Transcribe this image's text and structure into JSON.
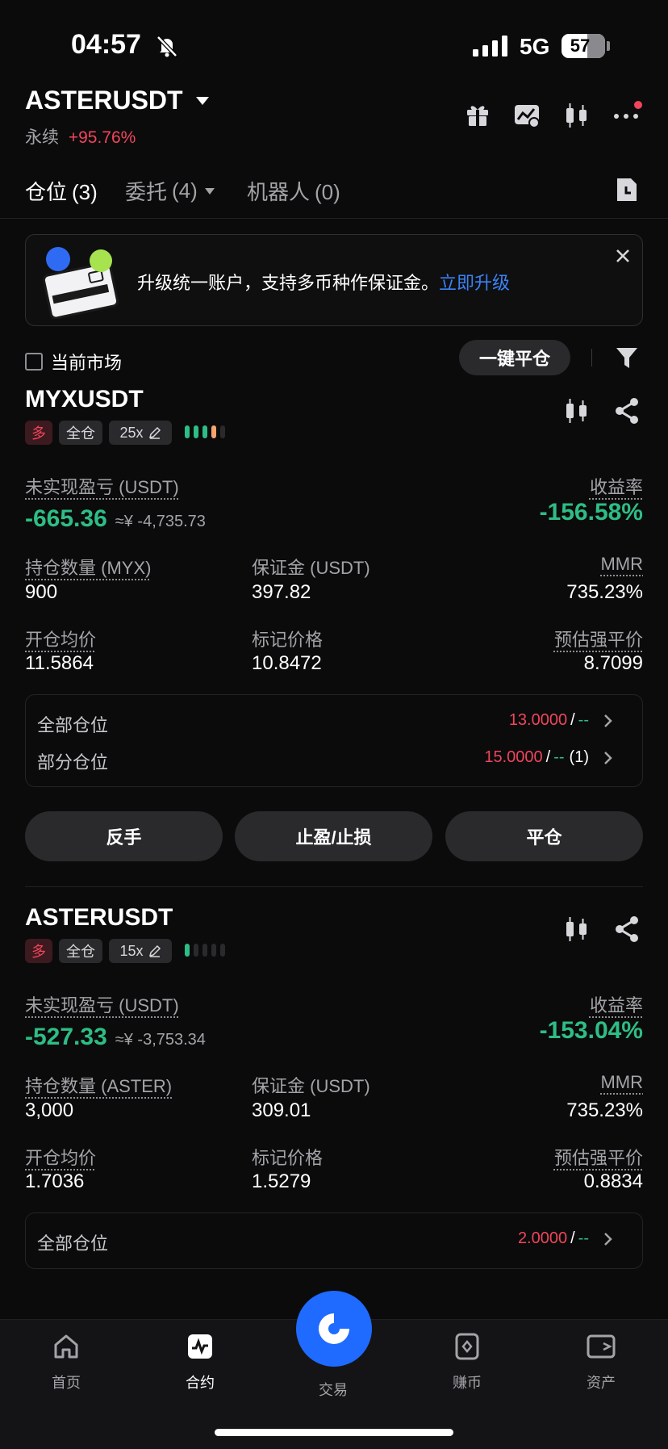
{
  "status": {
    "time": "04:57",
    "network": "5G",
    "battery": "57"
  },
  "header": {
    "symbol": "ASTERUSDT",
    "type": "永续",
    "change": "+95.76%"
  },
  "tabs": [
    {
      "label": "仓位",
      "count": "(3)"
    },
    {
      "label": "委托",
      "count": "(4)"
    },
    {
      "label": "机器人",
      "count": "(0)"
    }
  ],
  "banner": {
    "text": "升级统一账户，支持多币种作保证金。",
    "link": "立即升级"
  },
  "filter": {
    "current_market": "当前市场",
    "close_all": "一键平仓"
  },
  "positions": [
    {
      "symbol": "MYXUSDT",
      "side": "多",
      "margin_mode": "全仓",
      "leverage": "25x",
      "unrealized_label": "未实现盈亏 (USDT)",
      "unrealized": "-665.36",
      "unrealized_cny": "≈¥ -4,735.73",
      "roe_label": "收益率",
      "roe": "-156.58%",
      "qty_label": "持仓数量 (MYX)",
      "qty": "900",
      "margin_label": "保证金 (USDT)",
      "margin": "397.82",
      "mmr_label": "MMR",
      "mmr": "735.23%",
      "entry_label": "开仓均价",
      "entry": "11.5864",
      "mark_label": "标记价格",
      "mark": "10.8472",
      "liq_label": "预估强平价",
      "liq": "8.7099",
      "tpsl": [
        {
          "label": "全部仓位",
          "value": "13.0000",
          "sep": "/",
          "second": "--",
          "extra": ""
        },
        {
          "label": "部分仓位",
          "value": "15.0000",
          "sep": "/",
          "second": "--",
          "extra": "(1)"
        }
      ]
    },
    {
      "symbol": "ASTERUSDT",
      "side": "多",
      "margin_mode": "全仓",
      "leverage": "15x",
      "unrealized_label": "未实现盈亏 (USDT)",
      "unrealized": "-527.33",
      "unrealized_cny": "≈¥ -3,753.34",
      "roe_label": "收益率",
      "roe": "-153.04%",
      "qty_label": "持仓数量 (ASTER)",
      "qty": "3,000",
      "margin_label": "保证金 (USDT)",
      "margin": "309.01",
      "mmr_label": "MMR",
      "mmr": "735.23%",
      "entry_label": "开仓均价",
      "entry": "1.7036",
      "mark_label": "标记价格",
      "mark": "1.5279",
      "liq_label": "预估强平价",
      "liq": "0.8834",
      "tpsl": [
        {
          "label": "全部仓位",
          "value": "2.0000",
          "sep": "/",
          "second": "--",
          "extra": ""
        }
      ]
    }
  ],
  "actions": [
    "反手",
    "止盈/止损",
    "平仓"
  ],
  "nav": [
    "首页",
    "合约",
    "交易",
    "赚币",
    "资产"
  ],
  "colors": {
    "red": "#f0455b",
    "green": "#2ebd85",
    "orange": "#f6a56f",
    "accent": "#1f6bff",
    "link": "#3b82f6"
  }
}
